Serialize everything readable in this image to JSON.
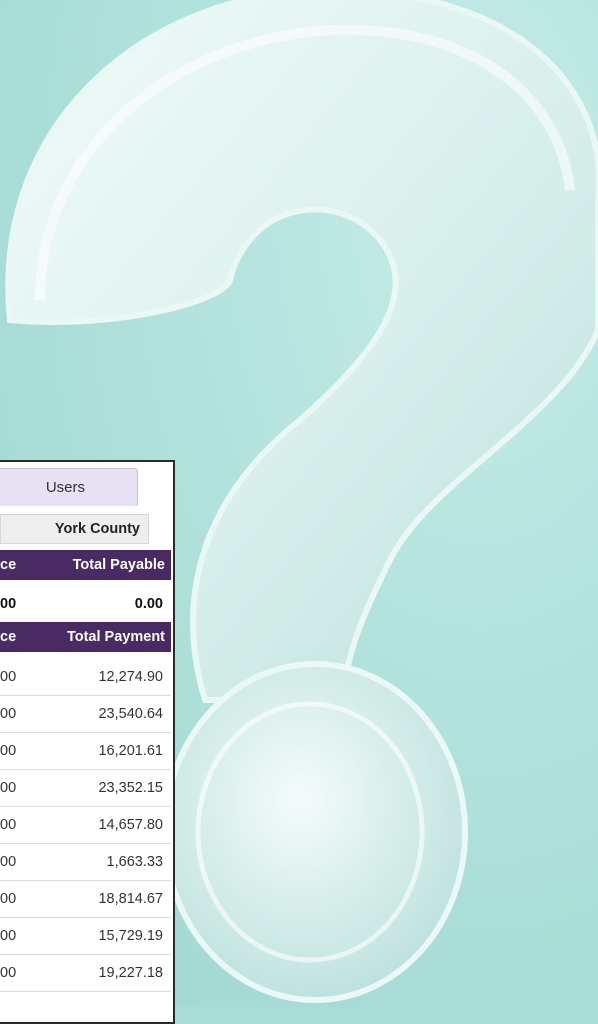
{
  "tab": {
    "label": "Users"
  },
  "county": {
    "label": "York County"
  },
  "payable_header": {
    "left_fragment": "ce",
    "right": "Total Payable"
  },
  "payable_row": {
    "left_fragment": "00",
    "right": "0.00"
  },
  "payment_header": {
    "left_fragment": "ce",
    "right": "Total Payment"
  },
  "payments": [
    {
      "left_fragment": "00",
      "total": "12,274.90"
    },
    {
      "left_fragment": "00",
      "total": "23,540.64"
    },
    {
      "left_fragment": "00",
      "total": "16,201.61"
    },
    {
      "left_fragment": "00",
      "total": "23,352.15"
    },
    {
      "left_fragment": "00",
      "total": "14,657.80"
    },
    {
      "left_fragment": "00",
      "total": "1,663.33"
    },
    {
      "left_fragment": "00",
      "total": "18,814.67"
    },
    {
      "left_fragment": "00",
      "total": "15,729.19"
    },
    {
      "left_fragment": "00",
      "total": "19,227.18"
    }
  ],
  "colors": {
    "background": "#a9dcd6",
    "header_purple": "#4a2a63",
    "tab_lavender": "#e8e0f3"
  },
  "decor": {
    "icon": "question-mark-icon"
  }
}
